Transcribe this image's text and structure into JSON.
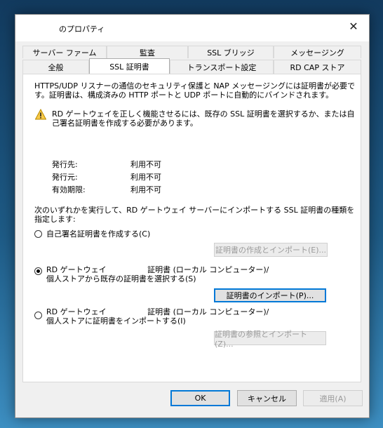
{
  "window": {
    "title": "のプロパティ",
    "close_glyph": "✕"
  },
  "tabs_row1": [
    "サーバー ファーム",
    "監査",
    "SSL ブリッジ",
    "メッセージング"
  ],
  "tabs_row2": [
    "全般",
    "SSL 証明書",
    "トランスポート設定",
    "RD CAP ストア"
  ],
  "active_tab": "SSL 証明書",
  "intro": {
    "line1": "HTTPS/UDP リスナーの通信のセキュリティ保護と NAP メッセージングには証明書が必要で",
    "line2": "す。証明書は、構成済みの HTTP ポートと UDP ポートに自動的にバインドされます。"
  },
  "warning": {
    "icon": "warning-icon",
    "line1": "RD ゲートウェイを正しく機能させるには、既存の SSL 証明書を選択するか、または自",
    "line2": "己署名証明書を作成する必要があります。"
  },
  "cert_info": [
    {
      "label": "発行先:",
      "value": "利用不可"
    },
    {
      "label": "発行元:",
      "value": "利用不可"
    },
    {
      "label": "有効期限:",
      "value": "利用不可"
    }
  ],
  "instruction": {
    "line1": "次のいずれかを実行して、RD ゲートウェイ サーバーにインポートする SSL 証明書の種類を",
    "line2": "指定します:"
  },
  "options": [
    {
      "line1": "自己署名証明書を作成する(C)",
      "line2": "",
      "checked": false,
      "button": "証明書の作成とインポート(E)...",
      "button_enabled": false
    },
    {
      "line1": "RD ゲートウェイ 　　　　　証明書 (ローカル コンピューター)/",
      "line2": "個人ストアから既存の証明書を選択する(S)",
      "checked": true,
      "button": "証明書のインポート(P)...",
      "button_enabled": true
    },
    {
      "line1": "RD ゲートウェイ 　　　　　証明書 (ローカル コンピューター)/",
      "line2": "個人ストアに証明書をインポートする(I)",
      "checked": false,
      "button": "証明書の参照とインポート(Z)...",
      "button_enabled": false
    }
  ],
  "footer": {
    "ok": "OK",
    "cancel": "キャンセル",
    "apply": "適用(A)"
  }
}
